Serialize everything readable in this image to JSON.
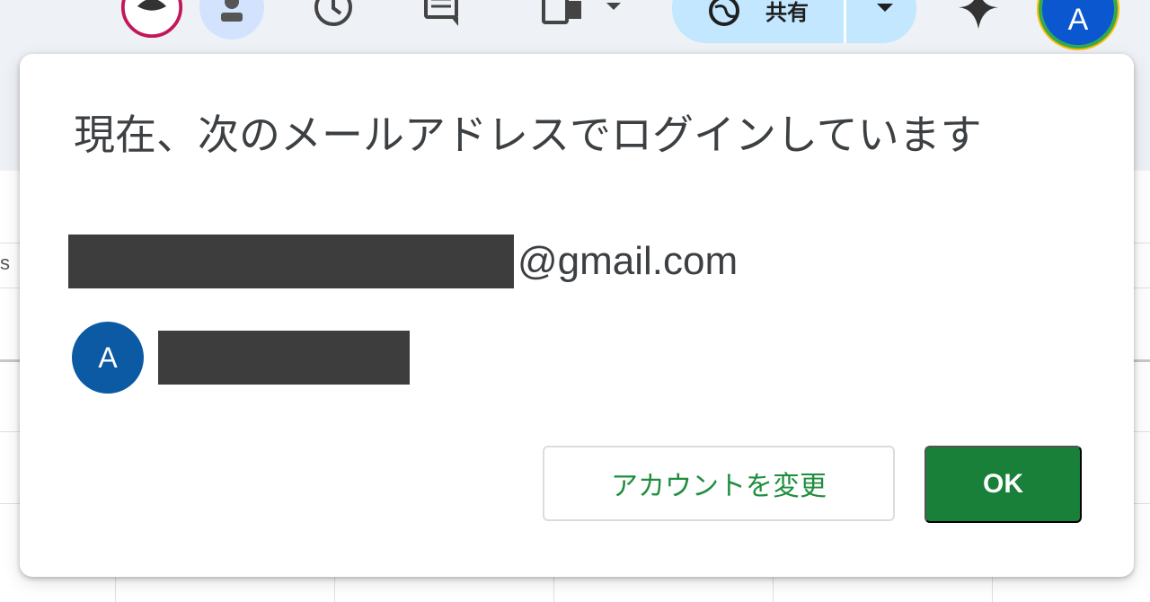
{
  "toolbar": {
    "share_label": "共有",
    "account_initial": "A",
    "icons": [
      "meet-icon",
      "person-icon",
      "history-icon",
      "comment-icon",
      "copy-icon",
      "share-globe-icon",
      "gemini-icon"
    ]
  },
  "background": {
    "cell_label": "s"
  },
  "dialog": {
    "title": "現在、次のメールアドレスでログインしています",
    "email_domain": "@gmail.com",
    "account_initial": "A",
    "change_account_label": "アカウントを変更",
    "ok_label": "OK"
  },
  "colors": {
    "accent_green": "#188038",
    "avatar_blue": "#0b5aa3",
    "share_bg": "#c2e7ff"
  }
}
